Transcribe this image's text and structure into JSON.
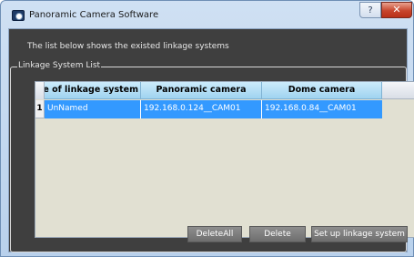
{
  "window": {
    "title": "Panoramic Camera Software",
    "help_label": "?",
    "close_label": "✕"
  },
  "main": {
    "description": "The list below shows the existed linkage systems",
    "group_label": "Linkage System List"
  },
  "table": {
    "columns": [
      "Name of linkage system",
      "Panoramic camera",
      "Dome camera"
    ],
    "rows": [
      {
        "index": "1",
        "name": "UnNamed",
        "panoramic": "192.168.0.124__CAM01",
        "dome": "192.168.0.84__CAM01"
      }
    ],
    "selected_row": 0,
    "selection_color": "#3399ff",
    "header_color": "#b5dff6"
  },
  "buttons": {
    "delete_all": "DeleteAll",
    "delete": "Delete",
    "setup": "Set up linkage system"
  }
}
